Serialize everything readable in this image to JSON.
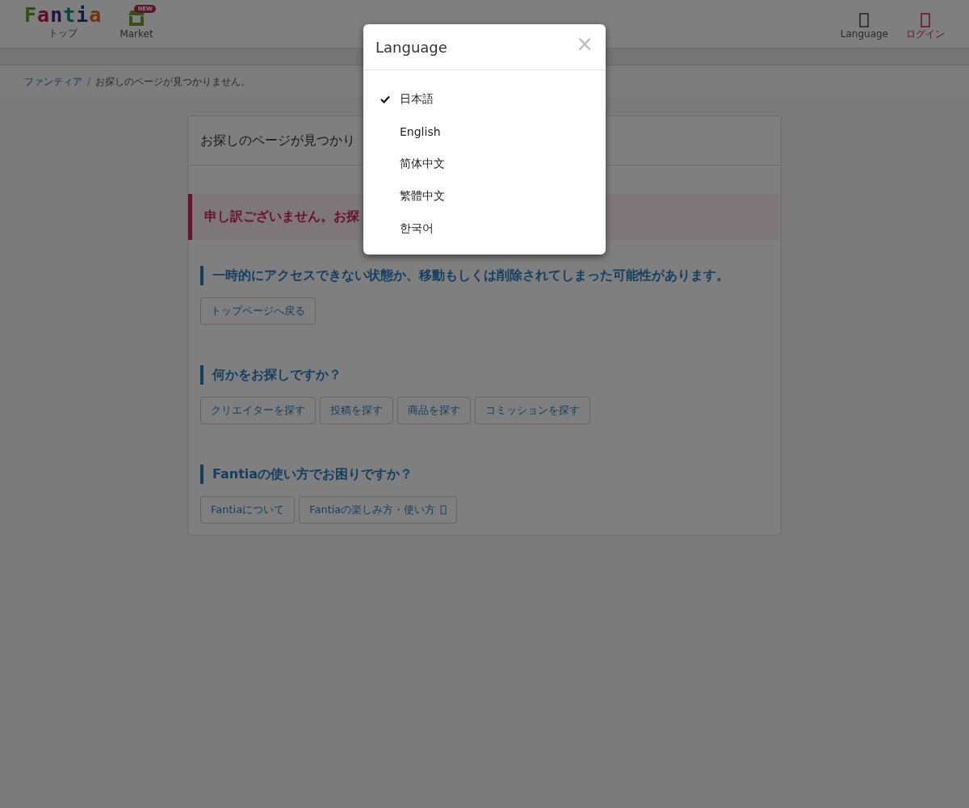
{
  "header": {
    "logo": "Fantia",
    "logo_caption": "トップ",
    "market": {
      "label": "Market",
      "badge": "NEW"
    },
    "language": "Language",
    "login": "ログイン"
  },
  "breadcrumb": {
    "separator": "/",
    "items": [
      {
        "label": "ファンティア",
        "link": true
      },
      {
        "label": "お探しのページが見つかりません。",
        "link": false
      }
    ]
  },
  "card": {
    "title": "お探しのページが見つかり",
    "alert": "申し訳ございません。お探",
    "sections": [
      {
        "heading": "一時的にアクセスできない状態か、移動もしくは削除されてしまった可能性があります。",
        "buttons": [
          {
            "label": "トップページへ戻る",
            "external": false
          }
        ]
      },
      {
        "heading": "何かをお探しですか？",
        "buttons": [
          {
            "label": "クリエイターを探す",
            "external": false
          },
          {
            "label": "投稿を探す",
            "external": false
          },
          {
            "label": "商品を探す",
            "external": false
          },
          {
            "label": "コミッションを探す",
            "external": false
          }
        ]
      },
      {
        "heading": "Fantiaの使い方でお困りですか？",
        "buttons": [
          {
            "label": "Fantiaについて",
            "external": false
          },
          {
            "label": "Fantiaの楽しみ方・使い方",
            "external": true
          }
        ]
      }
    ]
  },
  "modal": {
    "title": "Language",
    "close": "×",
    "options": [
      {
        "label": "日本語",
        "selected": true
      },
      {
        "label": "English",
        "selected": false
      },
      {
        "label": "简体中文",
        "selected": false
      },
      {
        "label": "繁體中文",
        "selected": false
      },
      {
        "label": "한국어",
        "selected": false
      }
    ]
  }
}
